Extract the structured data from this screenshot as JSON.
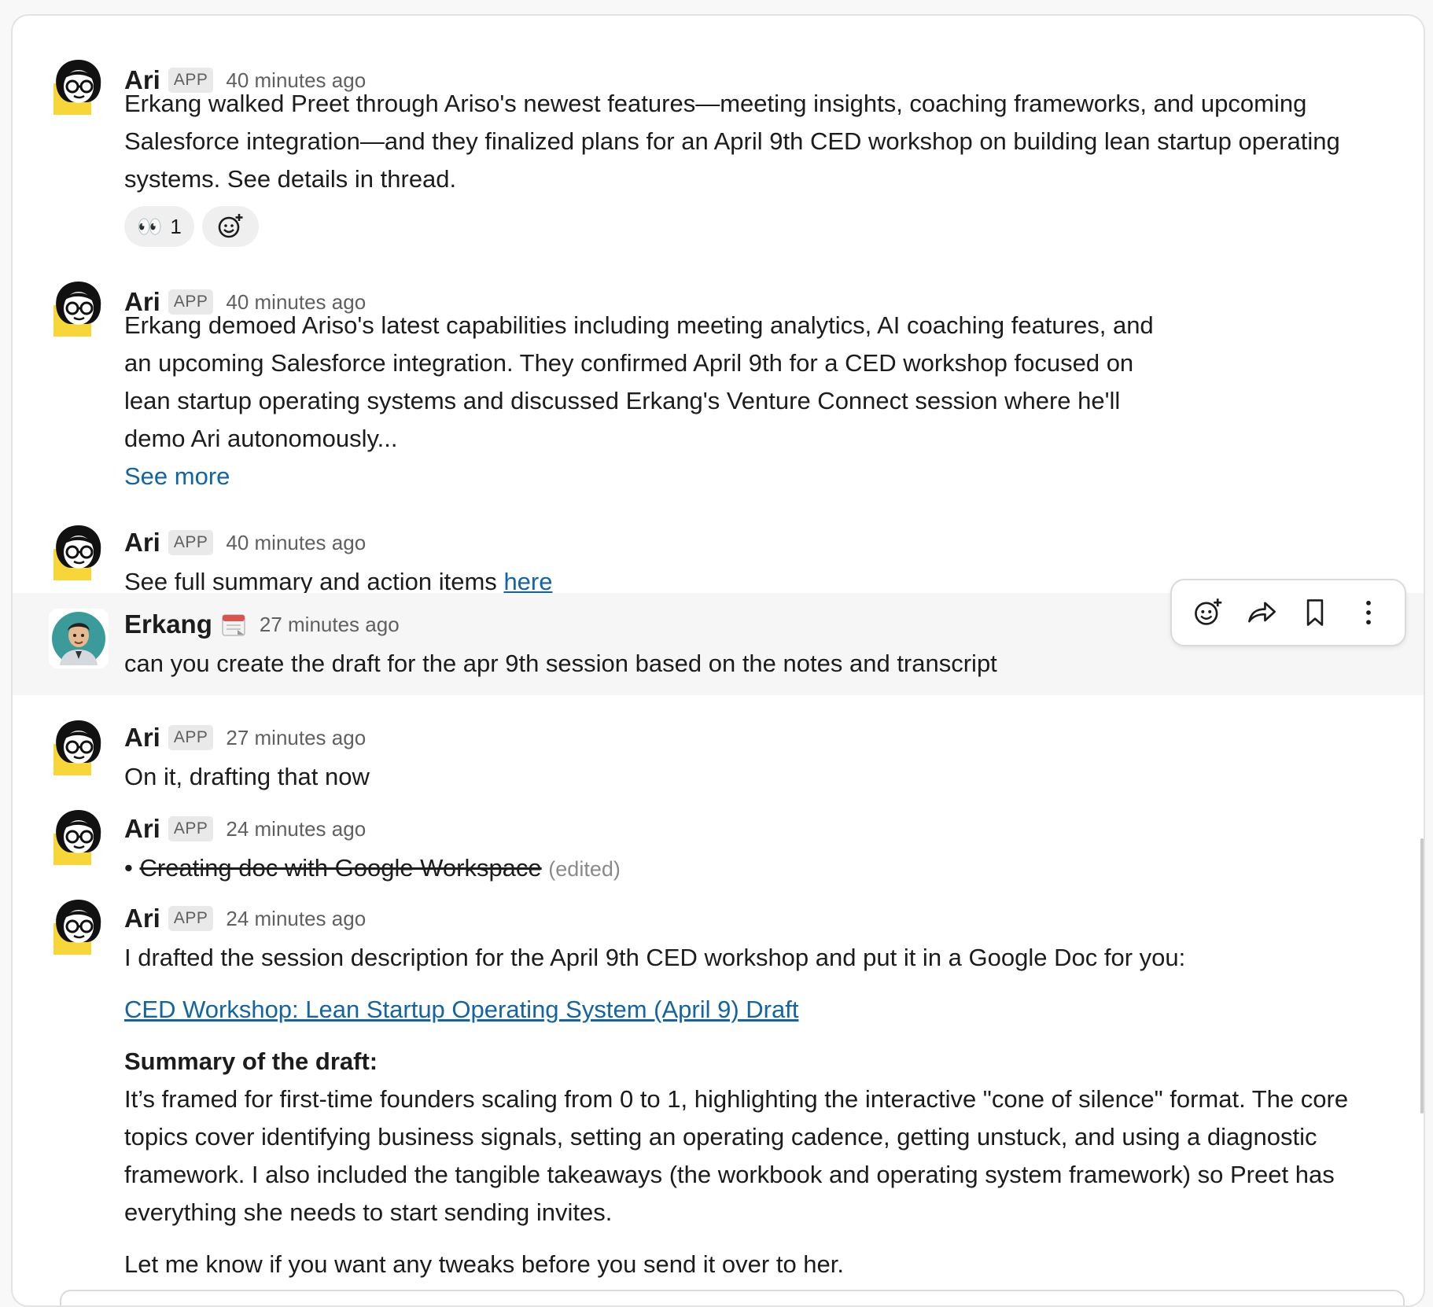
{
  "messages": [
    {
      "sender": "Ari",
      "badge": "APP",
      "time": "40 minutes ago",
      "text": "Erkang walked Preet through Ariso's newest features—meeting insights, coaching frameworks, and upcoming Salesforce integration—and they finalized plans for an April 9th CED workshop on building lean startup operating systems. See details in thread.",
      "reactions": [
        {
          "emoji": "👀",
          "count": "1"
        }
      ]
    },
    {
      "sender": "Ari",
      "badge": "APP",
      "time": "40 minutes ago",
      "text": "Erkang demoed Ariso's latest capabilities including meeting analytics, AI coaching features, and an upcoming Salesforce integration. They confirmed April 9th for a CED workshop focused on lean startup operating systems and discussed Erkang's Venture Connect session where he'll demo Ari autonomously...",
      "see_more": "See more"
    },
    {
      "sender": "Ari",
      "badge": "APP",
      "time": "40 minutes ago",
      "text": "See full summary and action items ",
      "link": "here"
    },
    {
      "sender": "Erkang",
      "time": "27 minutes ago",
      "text": "can you create the draft for the apr 9th session based on the notes and transcript"
    },
    {
      "sender": "Ari",
      "badge": "APP",
      "time": "27 minutes ago",
      "text": "On it, drafting that now"
    },
    {
      "sender": "Ari",
      "badge": "APP",
      "time": "24 minutes ago",
      "bullet": "•",
      "text": "Creating doc with Google Workspace",
      "edited": "(edited)"
    },
    {
      "sender": "Ari",
      "badge": "APP",
      "time": "24 minutes ago",
      "intro": "I drafted the session description for the April 9th CED workshop and put it in a Google Doc for you:",
      "doc_link": "CED Workshop: Lean Startup Operating System (April 9) Draft",
      "summary_heading": "Summary of the draft:",
      "summary": "It’s framed for first-time founders scaling from 0 to 1, highlighting the interactive \"cone of silence\" format. The core topics cover identifying business signals, setting an operating cadence, getting unstuck, and using a diagnostic framework. I also included the tangible takeaways (the workbook and operating system framework) so Preet has everything she needs to start sending invites.",
      "closing": "Let me know if you want any tweaks before you send it over to her."
    }
  ],
  "toolbar": {
    "icons": [
      "add-reaction-icon",
      "forward-icon",
      "bookmark-icon",
      "more-actions-icon"
    ]
  },
  "colors": {
    "link": "#1264a3",
    "avatar_yellow": "#f7d63a",
    "highlight_row": "#f6f6f6"
  }
}
